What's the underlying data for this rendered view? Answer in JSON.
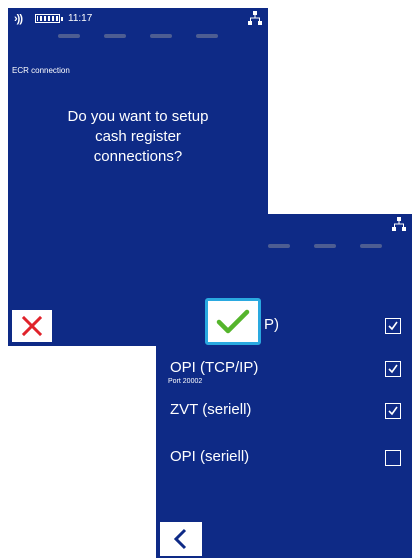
{
  "status": {
    "time": "11:17"
  },
  "screen1": {
    "title": "ECR connection",
    "question_lines": [
      "Do you want to setup",
      "cash register",
      "connections?"
    ]
  },
  "screen2": {
    "options": [
      {
        "label": "P)",
        "sublabel": "",
        "checked": true
      },
      {
        "label": "OPI (TCP/IP)",
        "sublabel": "Port 20002",
        "checked": true
      },
      {
        "label": "ZVT (seriell)",
        "sublabel": "",
        "checked": true
      },
      {
        "label": "OPI (seriell)",
        "sublabel": "",
        "checked": false
      }
    ]
  },
  "icons": {
    "nfc": "nfc-icon",
    "battery": "battery-icon",
    "network": "network-icon",
    "cancel": "x-icon",
    "confirm": "check-icon",
    "back": "chevron-left-icon"
  },
  "colors": {
    "background": "#0e2a86",
    "cancel": "#e0232b",
    "confirm": "#55b52c",
    "confirm_border": "#2aa9e0"
  }
}
